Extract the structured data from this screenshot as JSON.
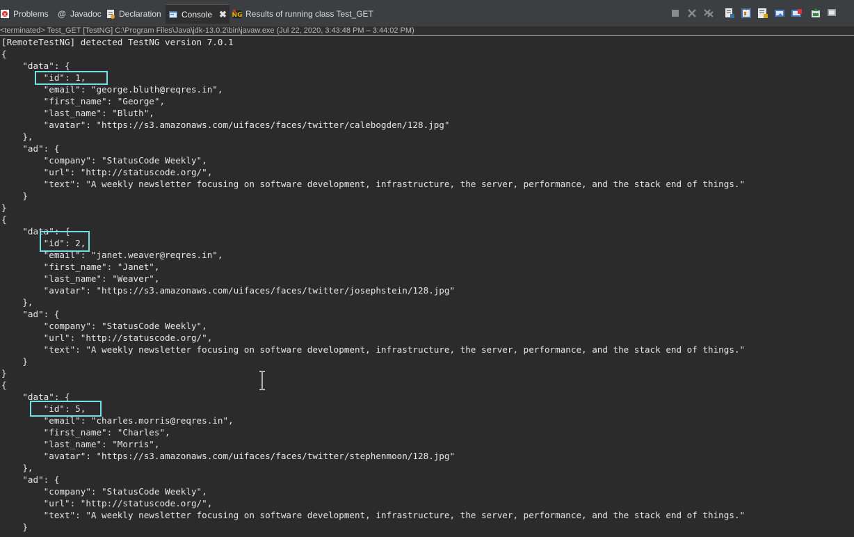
{
  "tabs": [
    {
      "label": "Problems",
      "icon": "problems-icon"
    },
    {
      "label": "Javadoc",
      "icon": "javadoc-icon"
    },
    {
      "label": "Declaration",
      "icon": "declaration-icon"
    },
    {
      "label": "Console",
      "icon": "console-icon",
      "close": "✖"
    },
    {
      "label": "Results of running class Test_GET",
      "icon": "testng-results-icon"
    }
  ],
  "toolbar_icons": [
    "terminate-icon",
    "remove-launch-icon",
    "remove-all-terminated-icon",
    "scroll-lock-icon",
    "show-console-output-icon",
    "show-console-error-icon",
    "pin-console-icon",
    "word-wrap-icon",
    "open-console-icon",
    "display-selected-console-icon"
  ],
  "console": {
    "description": "<terminated> Test_GET [TestNG] C:\\Program Files\\Java\\jdk-13.0.2\\bin\\javaw.exe  (Jul 22, 2020, 3:43:48 PM – 3:44:02 PM)",
    "lines": [
      "[RemoteTestNG] detected TestNG version 7.0.1",
      "{",
      "    \"data\": {",
      "        \"id\": 1,",
      "        \"email\": \"george.bluth@reqres.in\",",
      "        \"first_name\": \"George\",",
      "        \"last_name\": \"Bluth\",",
      "        \"avatar\": \"https://s3.amazonaws.com/uifaces/faces/twitter/calebogden/128.jpg\"",
      "    },",
      "    \"ad\": {",
      "        \"company\": \"StatusCode Weekly\",",
      "        \"url\": \"http://statuscode.org/\",",
      "        \"text\": \"A weekly newsletter focusing on software development, infrastructure, the server, performance, and the stack end of things.\"",
      "    }",
      "}",
      "{",
      "    \"data\": {",
      "        \"id\": 2,",
      "        \"email\": \"janet.weaver@reqres.in\",",
      "        \"first_name\": \"Janet\",",
      "        \"last_name\": \"Weaver\",",
      "        \"avatar\": \"https://s3.amazonaws.com/uifaces/faces/twitter/josephstein/128.jpg\"",
      "    },",
      "    \"ad\": {",
      "        \"company\": \"StatusCode Weekly\",",
      "        \"url\": \"http://statuscode.org/\",",
      "        \"text\": \"A weekly newsletter focusing on software development, infrastructure, the server, performance, and the stack end of things.\"",
      "    }",
      "}",
      "{",
      "    \"data\": {",
      "        \"id\": 5,",
      "        \"email\": \"charles.morris@reqres.in\",",
      "        \"first_name\": \"Charles\",",
      "        \"last_name\": \"Morris\",",
      "        \"avatar\": \"https://s3.amazonaws.com/uifaces/faces/twitter/stephenmoon/128.jpg\"",
      "    },",
      "    \"ad\": {",
      "        \"company\": \"StatusCode Weekly\",",
      "        \"url\": \"http://statuscode.org/\",",
      "        \"text\": \"A weekly newsletter focusing on software development, infrastructure, the server, performance, and the stack end of things.\"",
      "    }"
    ]
  },
  "colors": {
    "highlight": "#6fe3e8",
    "console_bg": "#2b2b2b",
    "text": "#e6e6e6"
  }
}
